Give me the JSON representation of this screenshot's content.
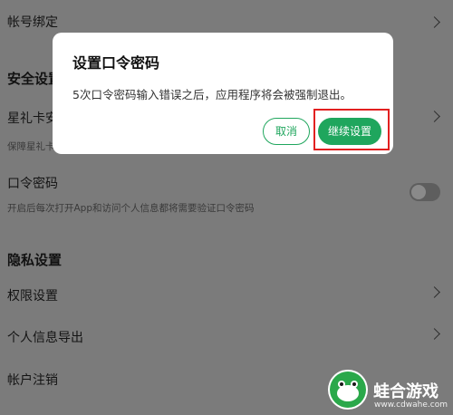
{
  "settings": {
    "account_binding": "帐号绑定",
    "security_section": "安全设置",
    "star_card_label": "星礼卡安",
    "star_card_sub": "保障星礼卡",
    "passcode_label": "口令密码",
    "passcode_sub": "开启后每次打开App和访问个人信息都将需要验证口令密码",
    "privacy_section": "隐私设置",
    "permissions": "权限设置",
    "export_info": "个人信息导出",
    "cancel_account": "帐户注销",
    "passcode_toggle_on": false
  },
  "dialog": {
    "title": "设置口令密码",
    "message": "5次口令密码输入错误之后，应用程序将会被强制退出。",
    "cancel_label": "取消",
    "continue_label": "继续设置"
  },
  "watermark": {
    "name": "蛙合游戏",
    "url": "www.cdwahe.com"
  },
  "colors": {
    "accent_green": "#1fa65d",
    "highlight_red": "#e22020",
    "overlay_gray": "#7b7b7b"
  }
}
